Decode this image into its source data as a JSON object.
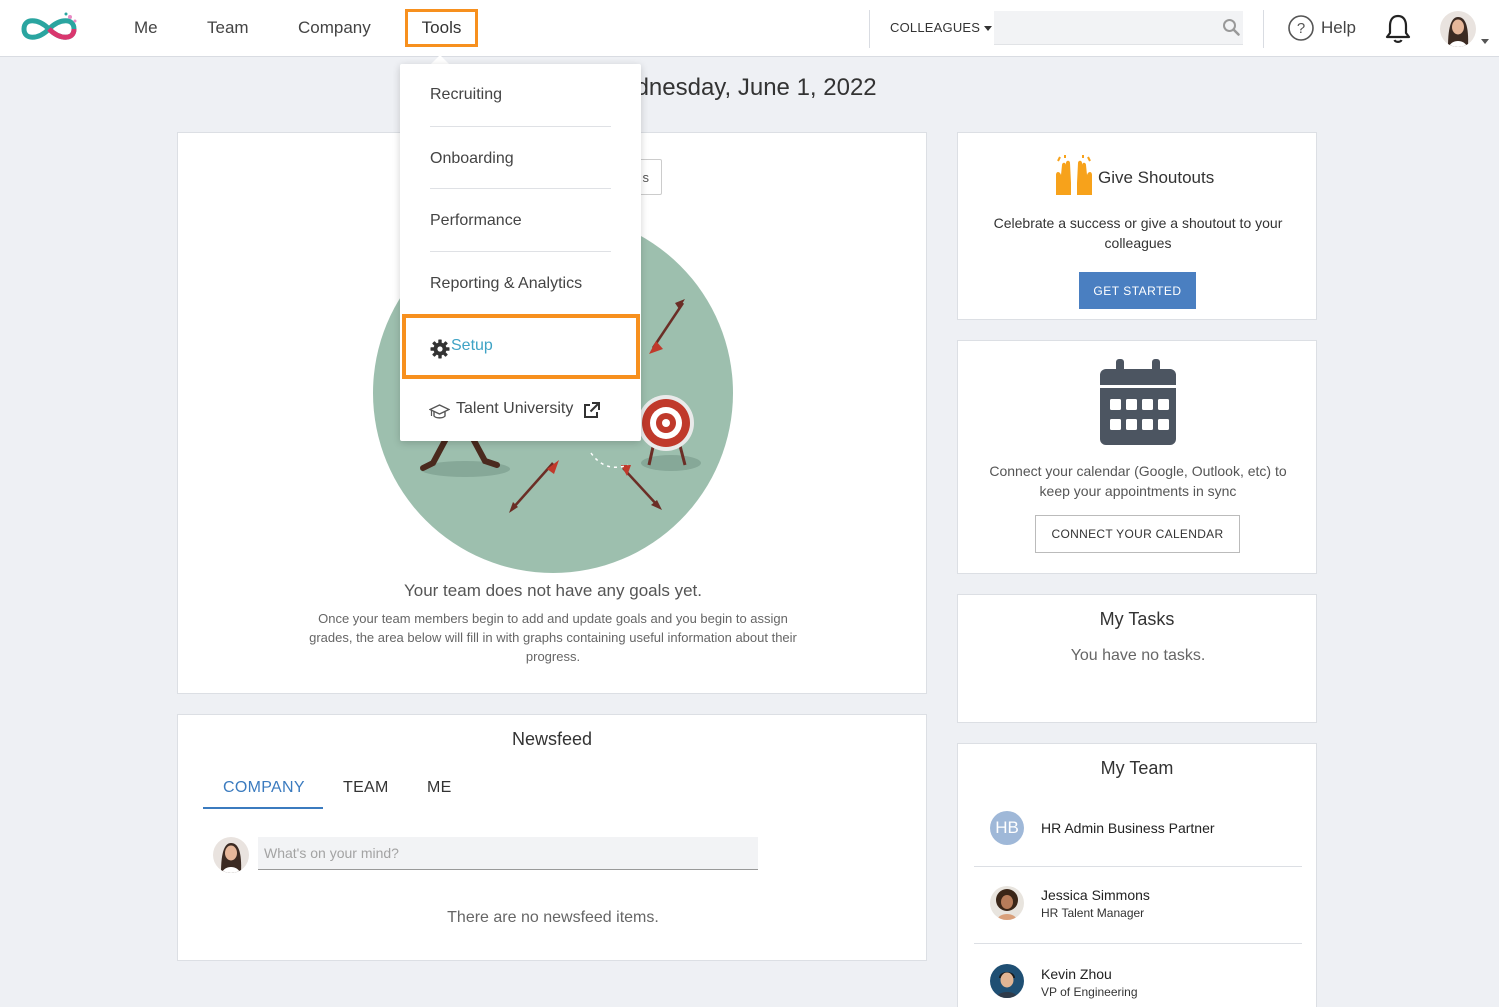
{
  "nav": {
    "me": "Me",
    "team": "Team",
    "company": "Company",
    "tools": "Tools",
    "colleagues": "COLLEAGUES",
    "help": "Help"
  },
  "date": "Wednesday, June 1, 2022",
  "tools_menu": {
    "items": [
      "Recruiting",
      "Onboarding",
      "Performance",
      "Reporting & Analytics"
    ],
    "setup": "Setup",
    "talent_university": "Talent University"
  },
  "goals": {
    "button_fragment": "s",
    "title": "Your team does not have any goals yet.",
    "description": "Once your team members begin to add and update goals and you begin to assign grades, the area below will fill in with graphs containing useful information about their progress."
  },
  "newsfeed": {
    "title": "Newsfeed",
    "tabs": [
      "COMPANY",
      "TEAM",
      "ME"
    ],
    "placeholder": "What's on your mind?",
    "empty": "There are no newsfeed items."
  },
  "shoutouts": {
    "title": "Give Shoutouts",
    "description": "Celebrate a success or give a shoutout to your colleagues",
    "button": "GET STARTED"
  },
  "calendar": {
    "description": "Connect your calendar (Google, Outlook, etc) to keep your appointments in sync",
    "button": "CONNECT YOUR CALENDAR"
  },
  "tasks": {
    "title": "My Tasks",
    "empty": "You have no tasks."
  },
  "my_team": {
    "title": "My Team",
    "members": [
      {
        "initials": "HB",
        "name": "HR Admin Business Partner",
        "role": ""
      },
      {
        "name": "Jessica Simmons",
        "role": "HR Talent Manager"
      },
      {
        "name": "Kevin Zhou",
        "role": "VP of Engineering"
      }
    ]
  },
  "colors": {
    "accent_orange": "#f7901e",
    "primary_blue": "#4a7fc1",
    "tab_blue": "#3b7bbf",
    "setup_link": "#3fa3c5",
    "illustration_green": "#9dbfae"
  }
}
